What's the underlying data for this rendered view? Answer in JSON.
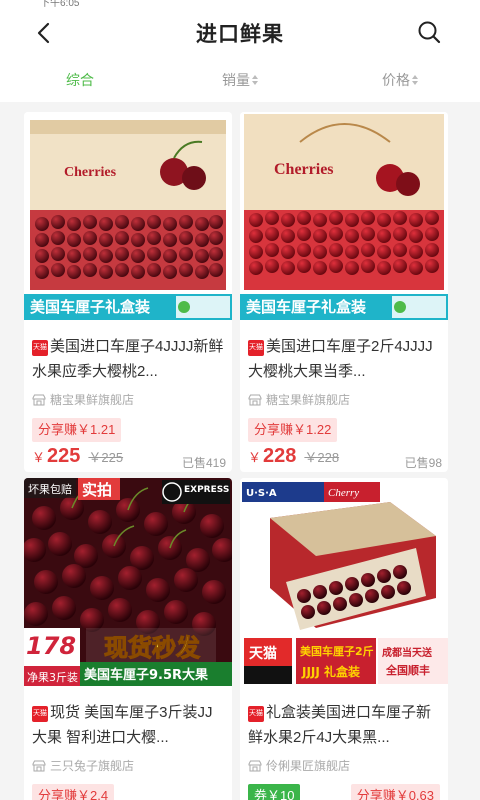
{
  "statusbar": {
    "text": "下午6:05"
  },
  "header": {
    "title": "进口鲜果"
  },
  "sort": [
    {
      "label": "综合"
    },
    {
      "label": "销量"
    },
    {
      "label": "价格"
    }
  ],
  "products": [
    {
      "badge": "天猫",
      "name": "美国进口车厘子4JJJJ新鲜水果应季大樱桃2...",
      "banner": "美国车厘子礼盒装",
      "box_text": "Cherries",
      "shop": "糖宝果鲜旗舰店",
      "share": "分享赚￥1.21",
      "yen": "￥",
      "price": "225",
      "original": "￥225",
      "sold": "已售419"
    },
    {
      "badge": "天猫",
      "name": "美国进口车厘子2斤4JJJJ大樱桃大果当季...",
      "banner": "美国车厘子礼盒装",
      "box_text": "Cherries",
      "shop": "糖宝果鲜旗舰店",
      "share": "分享赚￥1.22",
      "yen": "￥",
      "price": "228",
      "original": "￥228",
      "sold": "已售98"
    },
    {
      "badge": "天猫",
      "name": "现货 美国车厘子3斤装JJ大果 智利进口大樱...",
      "banner": "美国车厘子9.5R大果",
      "promo": "现货秒发",
      "price_tag": "178",
      "tag_sub": "净果3斤装",
      "top_left": "坏果包赔",
      "top_live": "实拍",
      "express": "EXPRESS",
      "shop": "三只兔子旗舰店",
      "share": "分享赚￥2.4"
    },
    {
      "badge": "天猫",
      "name": "礼盒装美国进口车厘子新鲜水果2斤4J大果黑...",
      "banner": "美国车厘子2斤",
      "banner2": "JJJJ 礼盒装",
      "tmall": "天猫",
      "chengdu": "成都当天送",
      "chengdu2": "全国顺丰",
      "usa": "U·S·A",
      "cherry": "Cherry",
      "shop": "伶俐果匠旗舰店",
      "coupon": "券￥10",
      "share": "分享赚￥0.63"
    }
  ]
}
